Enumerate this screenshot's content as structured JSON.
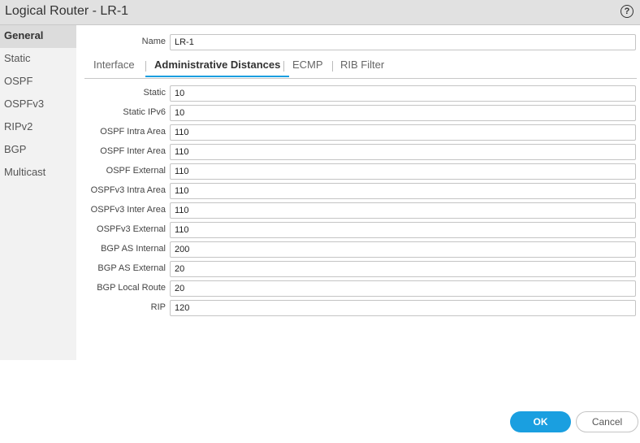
{
  "title": "Logical Router - LR-1",
  "help_label": "?",
  "sidebar": {
    "items": [
      {
        "label": "General"
      },
      {
        "label": "Static"
      },
      {
        "label": "OSPF"
      },
      {
        "label": "OSPFv3"
      },
      {
        "label": "RIPv2"
      },
      {
        "label": "BGP"
      },
      {
        "label": "Multicast"
      }
    ]
  },
  "name": {
    "label": "Name",
    "value": "LR-1"
  },
  "tabs": [
    {
      "label": "Interface"
    },
    {
      "label": "Administrative Distances"
    },
    {
      "label": "ECMP"
    },
    {
      "label": "RIB Filter"
    }
  ],
  "fields": [
    {
      "label": "Static",
      "value": "10"
    },
    {
      "label": "Static IPv6",
      "value": "10"
    },
    {
      "label": "OSPF Intra Area",
      "value": "110"
    },
    {
      "label": "OSPF Inter Area",
      "value": "110"
    },
    {
      "label": "OSPF External",
      "value": "110"
    },
    {
      "label": "OSPFv3 Intra Area",
      "value": "110"
    },
    {
      "label": "OSPFv3 Inter Area",
      "value": "110"
    },
    {
      "label": "OSPFv3 External",
      "value": "110"
    },
    {
      "label": "BGP AS Internal",
      "value": "200"
    },
    {
      "label": "BGP AS External",
      "value": "20"
    },
    {
      "label": "BGP Local Route",
      "value": "20"
    },
    {
      "label": "RIP",
      "value": "120"
    }
  ],
  "buttons": {
    "ok": "OK",
    "cancel": "Cancel"
  }
}
